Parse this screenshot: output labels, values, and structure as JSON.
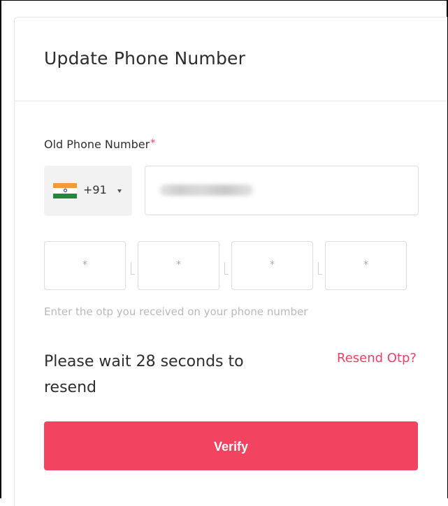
{
  "card": {
    "title": "Update Phone Number"
  },
  "old_phone": {
    "label": "Old Phone Number",
    "required_mark": "*",
    "country": {
      "flag": "india-flag-icon",
      "dial_code": "+91"
    },
    "value_obscured": true
  },
  "otp": {
    "digits": [
      "*",
      "*",
      "*",
      "*"
    ],
    "separator": "–",
    "hint": "Enter the otp you received on your phone number"
  },
  "resend": {
    "wait_message": "Please wait 28 seconds to resend",
    "link_label": "Resend Otp?"
  },
  "actions": {
    "verify_label": "Verify"
  },
  "colors": {
    "accent": "#f24461",
    "link": "#e83f63",
    "required": "#e73b5f",
    "country_bg": "#f2f2f2",
    "hint": "#b9b9b9"
  }
}
